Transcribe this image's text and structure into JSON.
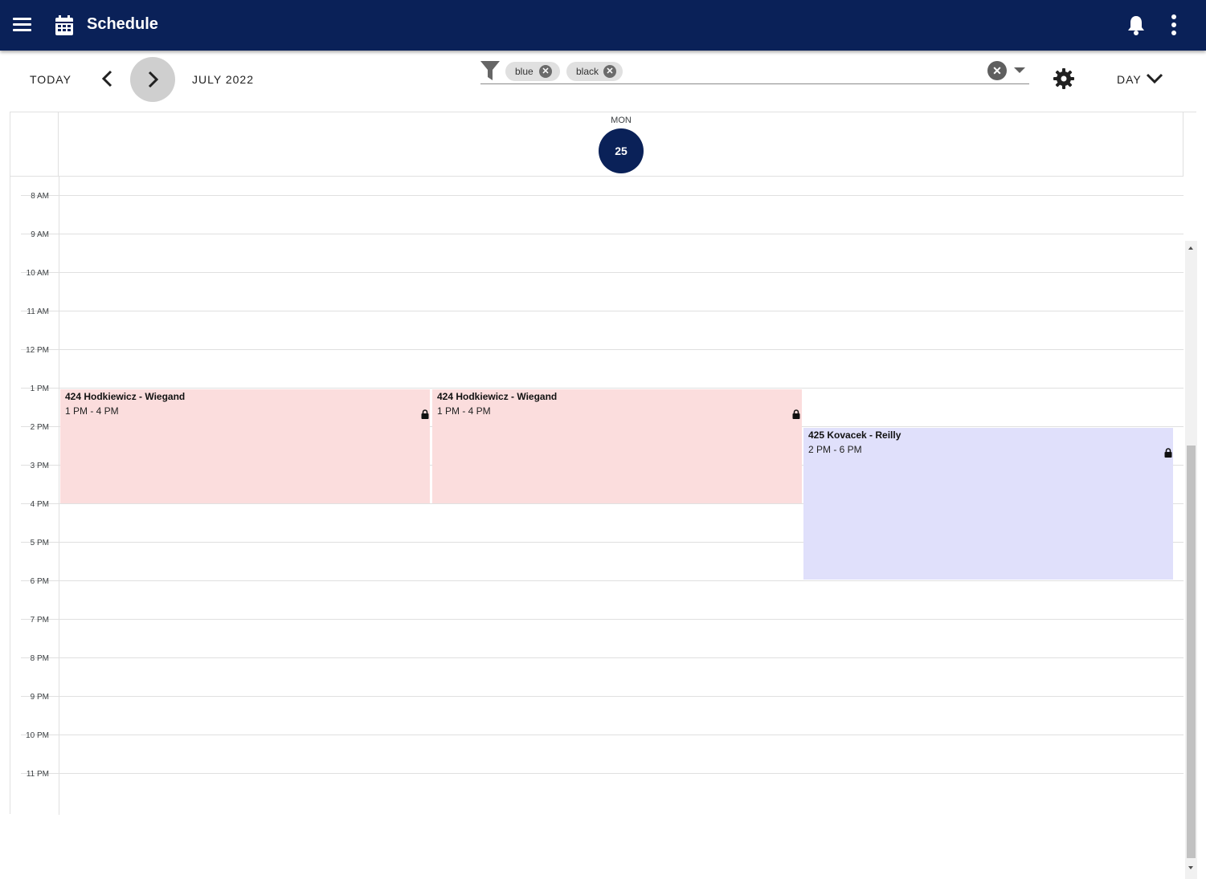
{
  "app": {
    "title": "Schedule",
    "brand_color": "#0a2158",
    "icons": [
      "menu-icon",
      "calendar-icon",
      "bell-icon",
      "more-vert-icon"
    ]
  },
  "toolbar": {
    "today_label": "TODAY",
    "month_label": "JULY 2022",
    "view_label": "DAY",
    "icons": [
      "chevron-left-icon",
      "chevron-right-icon",
      "settings-icon",
      "chevron-down-icon"
    ]
  },
  "filter": {
    "chips": [
      {
        "label": "blue"
      },
      {
        "label": "black"
      }
    ],
    "icons": [
      "filter-icon",
      "close-circle-icon",
      "dropdown-arrow-icon"
    ]
  },
  "day": {
    "weekday": "MON",
    "date": "25"
  },
  "time_labels": [
    "8 AM",
    "9 AM",
    "10 AM",
    "11 AM",
    "12 PM",
    "1 PM",
    "2 PM",
    "3 PM",
    "4 PM",
    "5 PM",
    "6 PM",
    "7 PM",
    "8 PM",
    "9 PM",
    "10 PM",
    "11 PM"
  ],
  "events": [
    {
      "title": "424 Hodkiewicz - Wiegand",
      "time": "1 PM - 4 PM",
      "color": "#fbdddd",
      "locked": true
    },
    {
      "title": "424 Hodkiewicz - Wiegand",
      "time": "1 PM - 4 PM",
      "color": "#fbdddd",
      "locked": true
    },
    {
      "title": "425 Kovacek - Reilly",
      "time": "2 PM - 6 PM",
      "color": "#e0e0fb",
      "locked": true
    }
  ]
}
